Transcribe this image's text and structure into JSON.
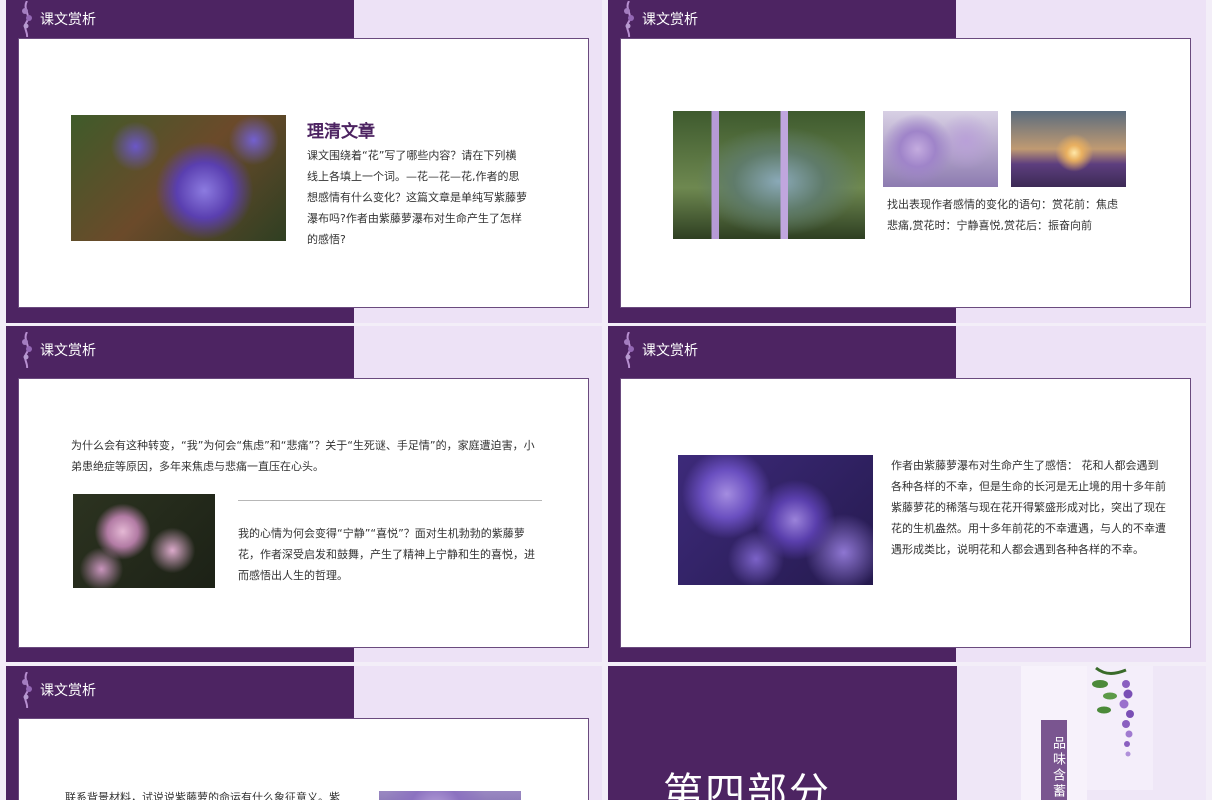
{
  "slides": {
    "s1": {
      "header": "课文赏析",
      "title": "理清文章",
      "body": "课文围绕着“花”写了哪些内容？请在下列横线上各填上一个词。—花—花—花,作者的思想感情有什么变化？这篇文章是单纯写紫藤萝瀑布吗?作者由紫藤萝瀑布对生命产生了怎样的感悟?"
    },
    "s2": {
      "header": "课文赏析",
      "body": "找出表现作者感情的变化的语句：赏花前：焦虑悲痛,赏花时：宁静喜悦,赏花后：振奋向前"
    },
    "s3": {
      "header": "课文赏析",
      "body1": "为什么会有这种转变，“我”为何会“焦虑”和“悲痛”？关于“生死谜、手足情”的，家庭遭迫害，小弟患绝症等原因，多年来焦虑与悲痛一直压在心头。",
      "body2": "我的心情为何会变得“宁静”“喜悦”？面对生机勃勃的紫藤萝花，作者深受启发和鼓舞，产生了精神上宁静和生的喜悦，进而感悟出人生的哲理。"
    },
    "s4": {
      "header": "课文赏析",
      "body": "作者由紫藤萝瀑布对生命产生了感悟： 花和人都会遇到各种各样的不幸，但是生命的长河是无止境的用十多年前紫藤萝花的稀落与现在花开得繁盛形成对比，突出了现在花的生机盎然。用十多年前花的不幸遭遇，与人的不幸遭遇形成类比，说明花和人都会遇到各种各样的不幸。"
    },
    "s5": {
      "header": "课文赏析",
      "body": "联系背景材料，试说说紫藤萝的命运有什么象征意义。紫"
    },
    "s6": {
      "big": "第四部分",
      "tab": "品味含蓄"
    }
  },
  "colors": {
    "purple": "#4d2462",
    "lilac": "#ede2f6"
  }
}
